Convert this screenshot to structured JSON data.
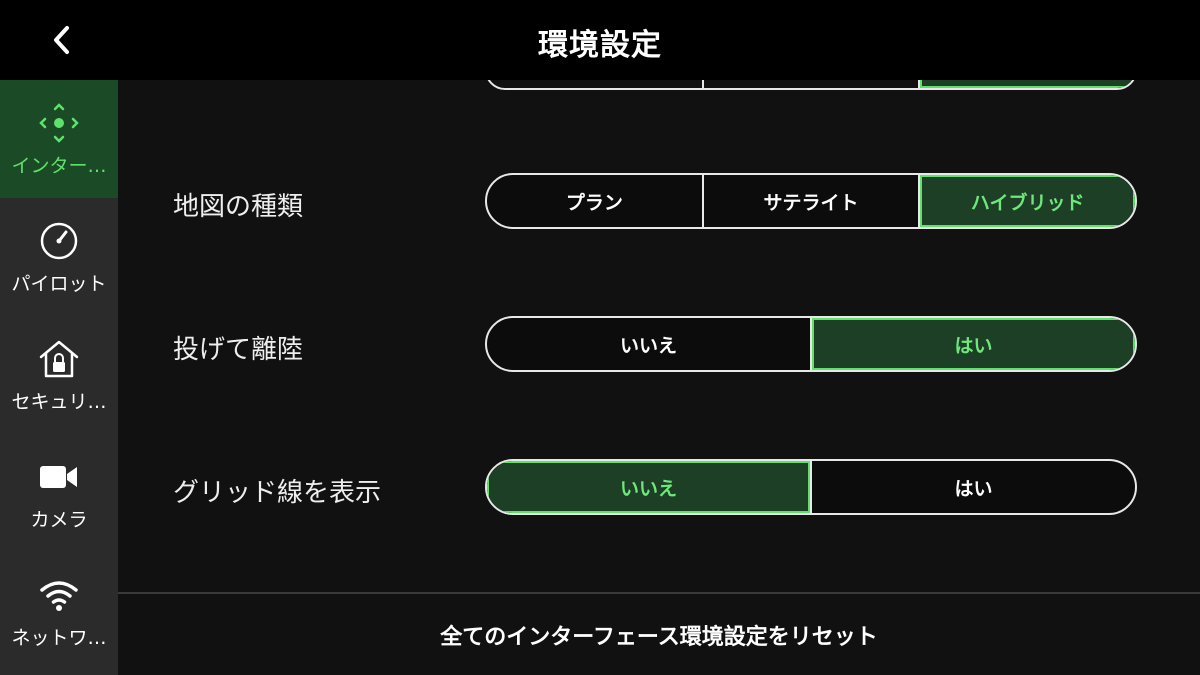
{
  "header": {
    "title": "環境設定",
    "back_icon": "chevron-left-icon"
  },
  "sidebar": {
    "items": [
      {
        "label": "インター…",
        "icon": "move-arrows-icon",
        "active": true
      },
      {
        "label": "パイロット",
        "icon": "gauge-icon",
        "active": false
      },
      {
        "label": "セキュリ…",
        "icon": "home-lock-icon",
        "active": false
      },
      {
        "label": "カメラ",
        "icon": "video-camera-icon",
        "active": false
      },
      {
        "label": "ネットワ…",
        "icon": "wifi-icon",
        "active": false
      }
    ]
  },
  "settings": {
    "map_type": {
      "label": "地図の種類",
      "options": [
        "プラン",
        "サテライト",
        "ハイブリッド"
      ],
      "selected": "ハイブリッド"
    },
    "throw_takeoff": {
      "label": "投げて離陸",
      "options": [
        "いいえ",
        "はい"
      ],
      "selected": "はい"
    },
    "show_grid": {
      "label": "グリッド線を表示",
      "options": [
        "いいえ",
        "はい"
      ],
      "selected": "いいえ"
    }
  },
  "footer": {
    "reset_label": "全てのインターフェース環境設定をリセット"
  },
  "colors": {
    "accent": "#5ee26b",
    "selected_bg": "#1c3f26",
    "sidebar_active_bg": "#1b4a26",
    "sidebar_bg": "#2b2b2b",
    "header_bg": "#000000"
  }
}
